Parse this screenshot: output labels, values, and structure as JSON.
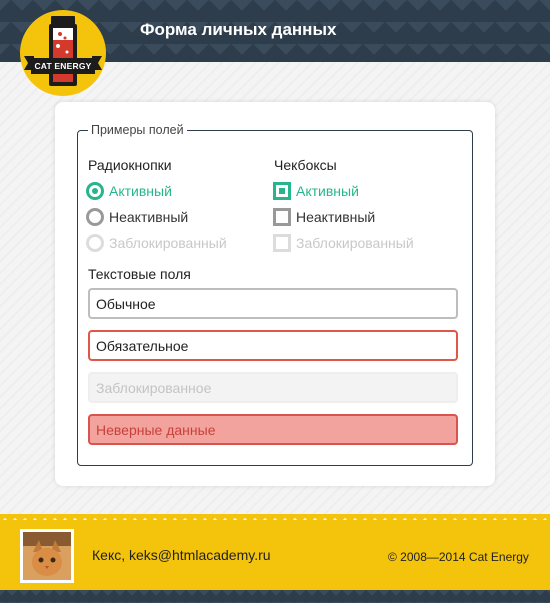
{
  "header": {
    "title": "Форма личных данных",
    "logo_text": "CAT ENERGY"
  },
  "form": {
    "legend": "Примеры полей",
    "radios": {
      "title": "Радиокнопки",
      "items": [
        {
          "label": "Активный",
          "state": "checked"
        },
        {
          "label": "Неактивный",
          "state": "unchecked"
        },
        {
          "label": "Заблокированный",
          "state": "disabled"
        }
      ]
    },
    "checkboxes": {
      "title": "Чекбоксы",
      "items": [
        {
          "label": "Активный",
          "state": "checked"
        },
        {
          "label": "Неактивный",
          "state": "unchecked"
        },
        {
          "label": "Заблокированный",
          "state": "disabled"
        }
      ]
    },
    "text_fields": {
      "title": "Текстовые поля",
      "items": [
        {
          "value": "Обычное",
          "state": "normal"
        },
        {
          "value": "Обязательное",
          "state": "required"
        },
        {
          "value": "Заблокированное",
          "state": "disabled"
        },
        {
          "value": "Неверные данные",
          "state": "error"
        }
      ]
    }
  },
  "footer": {
    "user": "Кекс, keks@htmlacademy.ru",
    "copyright": "© 2008—2014 Cat Energy"
  },
  "colors": {
    "accent": "#27b68c",
    "header": "#2e3d4c",
    "footer": "#f4c40d",
    "error": "#e0574a"
  }
}
